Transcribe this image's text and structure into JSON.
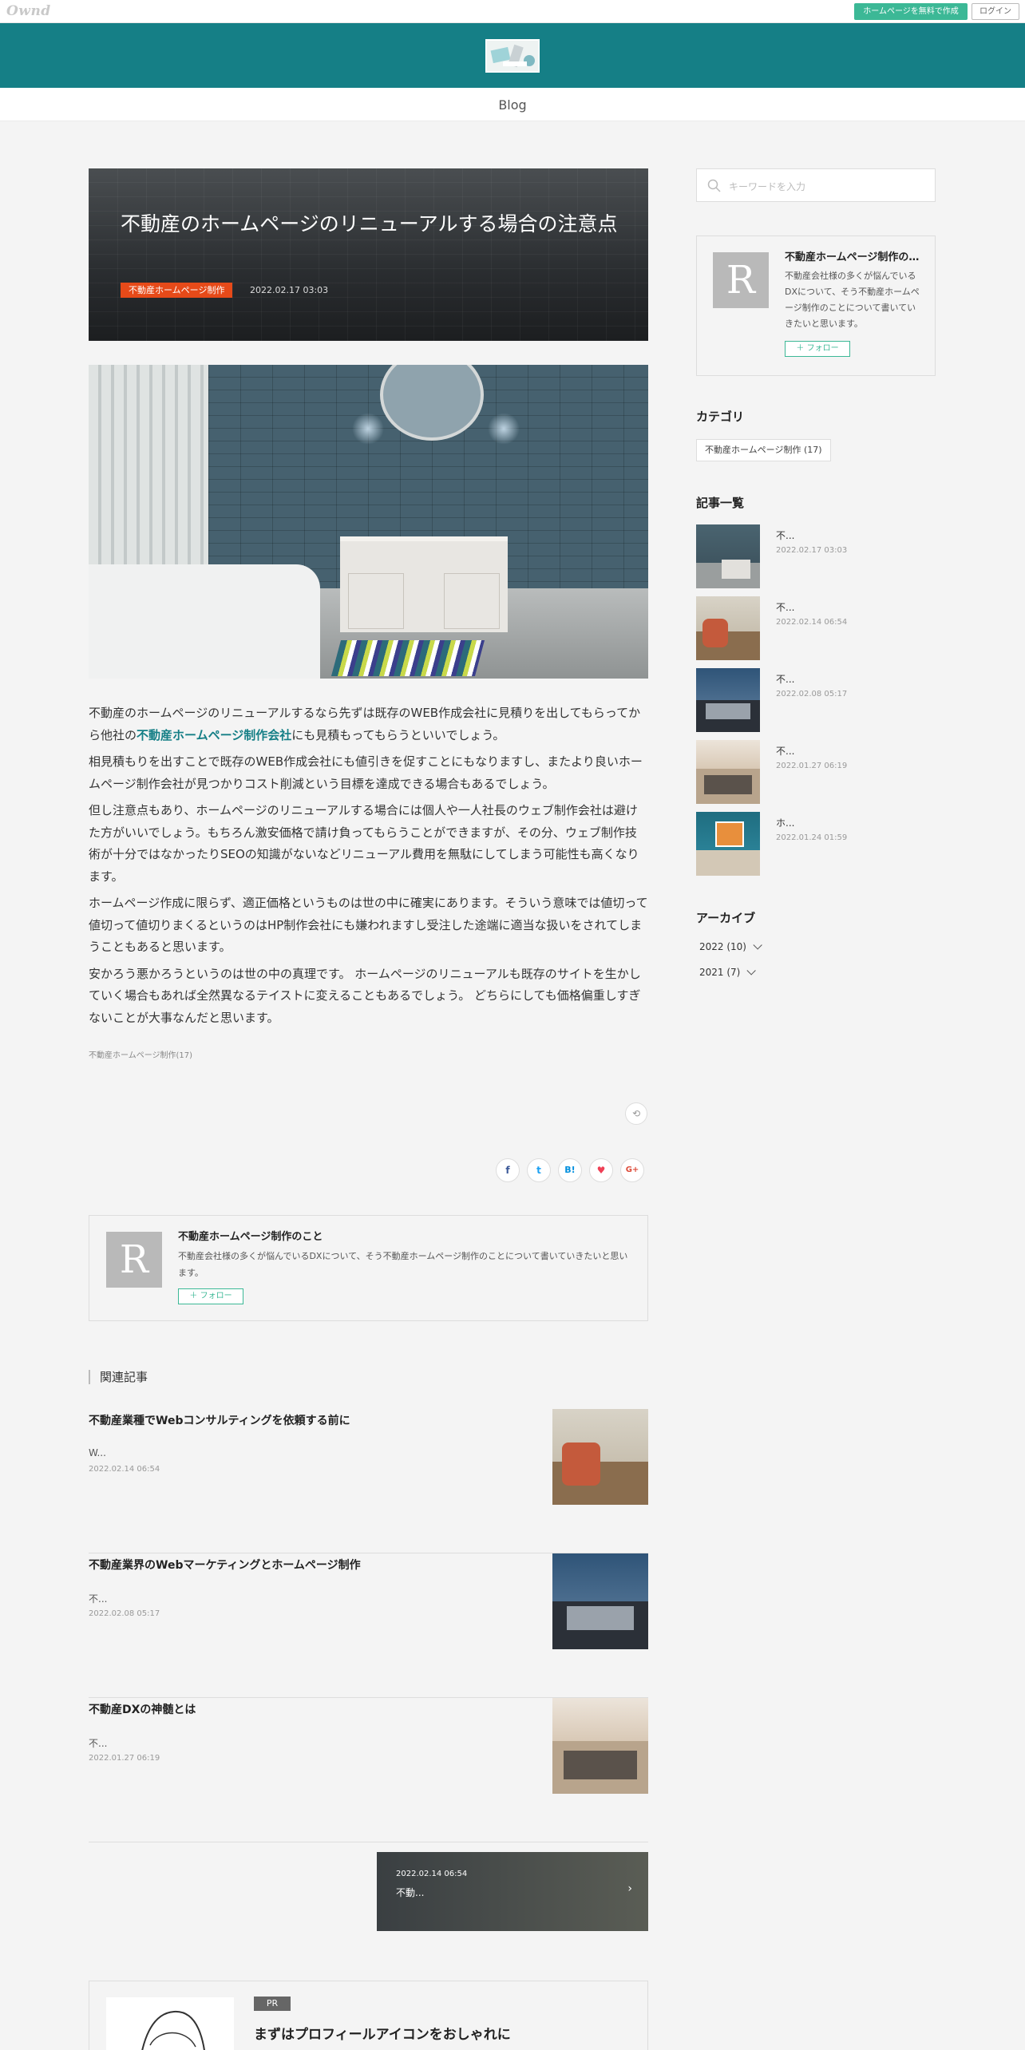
{
  "topbar": {
    "logo": "Ownd",
    "create_label": "ホームページを無料で作成",
    "login_label": "ログイン"
  },
  "nav": {
    "blog": "Blog"
  },
  "article": {
    "title": "不動産のホームページのリニューアルする場合の注意点",
    "category": "不動産ホームページ制作",
    "date": "2022.02.17 03:03",
    "paragraphs": [
      "相見積もりを出すことで既存のWEB作成会社にも値引きを促すことにもなりますし、またより良いホームページ制作会社が見つかりコスト削減という目標を達成できる場合もあるでしょう。",
      "但し注意点もあり、ホームページのリニューアルする場合には個人や一人社長のウェブ制作会社は避けた方がいいでしょう。もちろん激安価格で請け負ってもらうことができますが、その分、ウェブ制作技術が十分ではなかったりSEOの知識がないなどリニューアル費用を無駄にしてしまう可能性も高くなります。",
      "ホームページ作成に限らず、適正価格というものは世の中に確実にあります。そういう意味では値切って値切って値切りまくるというのはHP制作会社にも嫌われますし受注した途端に適当な扱いをされてしまうこともあると思います。",
      "安かろう悪かろうというのは世の中の真理です。 ホームページのリニューアルも既存のサイトを生かしていく場合もあれば全然異なるテイストに変えることもあるでしょう。 どちらにしても価格偏重しすぎないことが大事なんだと思います。"
    ],
    "first_para_a": "不動産のホームページのリニューアルするなら先ずは既存のWEB作成会社に見積りを出してもらってから他社の",
    "first_para_link": "不動産ホームページ制作会社",
    "first_para_b": "にも見積もってもらうといいでしょう。",
    "tag_line": "不動産ホームページ制作(17)"
  },
  "share": {
    "repost": "⟲",
    "facebook": "f",
    "twitter": "t",
    "hatena": "B!",
    "pocket": "♥",
    "google": "G+"
  },
  "author": {
    "initial": "R",
    "name": "不動産ホームページ制作のこと",
    "desc": "不動産会社様の多くが悩んでいるDXについて、そう不動産ホームページ制作のことについて書いていきたいと思います。",
    "follow": "＋ フォロー"
  },
  "related": {
    "heading": "関連記事",
    "items": [
      {
        "title": "不動産業種でWebコンサルティングを依頼する前に",
        "excerpt": "W...",
        "date": "2022.02.14 06:54"
      },
      {
        "title": "不動産業界のWebマーケティングとホームページ制作",
        "excerpt": "不...",
        "date": "2022.02.08 05:17"
      },
      {
        "title": "不動産DXの神髄とは",
        "excerpt": "不...",
        "date": "2022.01.27 06:19"
      }
    ]
  },
  "next_card": {
    "date": "2022.02.14 06:54",
    "title": "不動...",
    "arrow": "›"
  },
  "pr": {
    "badge": "PR",
    "title": "まずはプロフィールアイコンをおしゃれに"
  },
  "sidebar": {
    "search_placeholder": "キーワードを入力",
    "author_name": "不動産ホームページ制作のこと",
    "author_desc": "不動産会社様の多くが悩んでいるDXについて、そう不動産ホームページ制作のことについて書いていきたいと思います。",
    "category_heading": "カテゴリ",
    "category_chip": "不動産ホームページ制作  (17)",
    "list_heading": "記事一覧",
    "list": [
      {
        "title": "不...",
        "date": "2022.02.17 03:03"
      },
      {
        "title": "不...",
        "date": "2022.02.14 06:54"
      },
      {
        "title": "不...",
        "date": "2022.02.08 05:17"
      },
      {
        "title": "不...",
        "date": "2022.01.27 06:19"
      },
      {
        "title": "ホ...",
        "date": "2022.01.24 01:59"
      }
    ],
    "archive_heading": "アーカイブ",
    "archives": [
      "2022 (10)",
      "2021 (7)"
    ]
  },
  "colors": {
    "header": "#157f86",
    "accent_green": "#3cb896",
    "category_badge": "#e64a19"
  }
}
